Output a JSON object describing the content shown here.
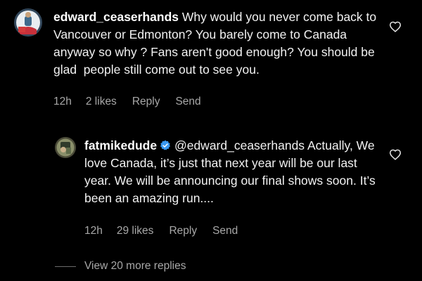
{
  "comment1": {
    "username": "edward_ceaserhands",
    "text": "Why would you never come back to Vancouver or Edmonton? You barely come to Canada anyway so why ? Fans aren't good enough? You should be glad  people still come out to see you.",
    "time": "12h",
    "likes": "2 likes",
    "reply_label": "Reply",
    "send_label": "Send"
  },
  "comment2": {
    "username": "fatmikedude",
    "mention": "@edward_ceaserhands",
    "text": "Actually, We love Canada, it’s just that next year will be our last year. We will be announcing our final shows soon. It’s been an amazing run....",
    "time": "12h",
    "likes": "29 likes",
    "reply_label": "Reply",
    "send_label": "Send"
  },
  "view_more": {
    "label": "View 20 more replies"
  },
  "colors": {
    "background": "#000000",
    "text": "#f2f2f2",
    "meta": "#a8a8a8",
    "verified": "#3897f0"
  },
  "icons": {
    "like": "heart-outline-icon",
    "verified": "verified-badge-icon"
  }
}
